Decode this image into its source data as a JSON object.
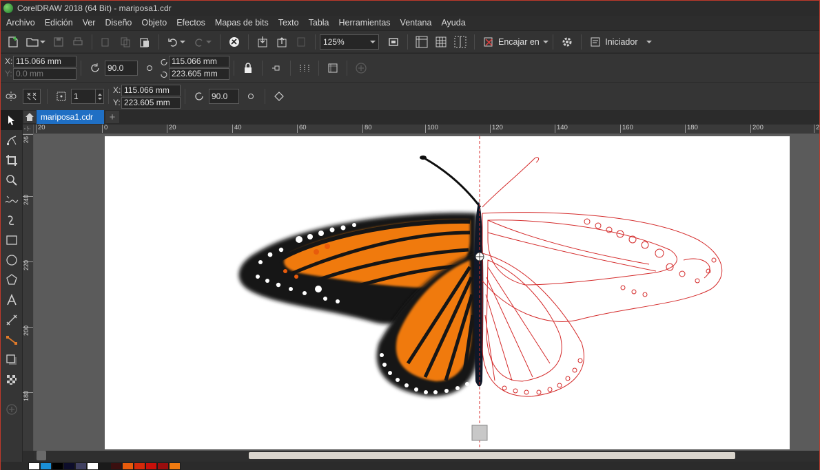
{
  "window": {
    "title": "CorelDRAW 2018 (64 Bit) - mariposa1.cdr"
  },
  "menu": [
    "Archivo",
    "Edición",
    "Ver",
    "Diseño",
    "Objeto",
    "Efectos",
    "Mapas de bits",
    "Texto",
    "Tabla",
    "Herramientas",
    "Ventana",
    "Ayuda"
  ],
  "toolbar": {
    "zoom_level": "125%",
    "snap_label": "Encajar en",
    "launcher_label": "Iniciador"
  },
  "property_bar": {
    "x_label": "X:",
    "y_label": "Y:",
    "x_value": "115.066 mm",
    "y_value": "0.0 mm",
    "rotation_angle": "90.0",
    "center_x": "115.066 mm",
    "center_y": "223.605 mm"
  },
  "symmetry_bar": {
    "line_count": "1",
    "x_label": "X:",
    "y_label": "Y:",
    "x_value": "115.066 mm",
    "y_value": "223.605 mm",
    "rotation_angle": "90.0"
  },
  "document": {
    "tab_name": "mariposa1.cdr"
  },
  "rulers": {
    "horizontal_labels": [
      "20",
      "0",
      "20",
      "40",
      "60",
      "80",
      "100",
      "120",
      "140",
      "160",
      "180",
      "200",
      "2"
    ],
    "vertical_labels": [
      "26",
      "240",
      "220",
      "200",
      "180"
    ]
  },
  "palette": {
    "colors": [
      "#ffffff",
      "#1a8fd6",
      "#000000",
      "#0d0d2a",
      "#404060",
      "#ffffff",
      "#1a1a1a",
      "#3a0f0f",
      "#e85b0c",
      "#d42a0a",
      "#c8100a",
      "#9a0e0e",
      "#f07a10"
    ]
  },
  "colors": {
    "accent": "#1f6fc4",
    "outline": "#d42a2a",
    "wing_orange": "#f07a10",
    "wing_black": "#151515"
  }
}
